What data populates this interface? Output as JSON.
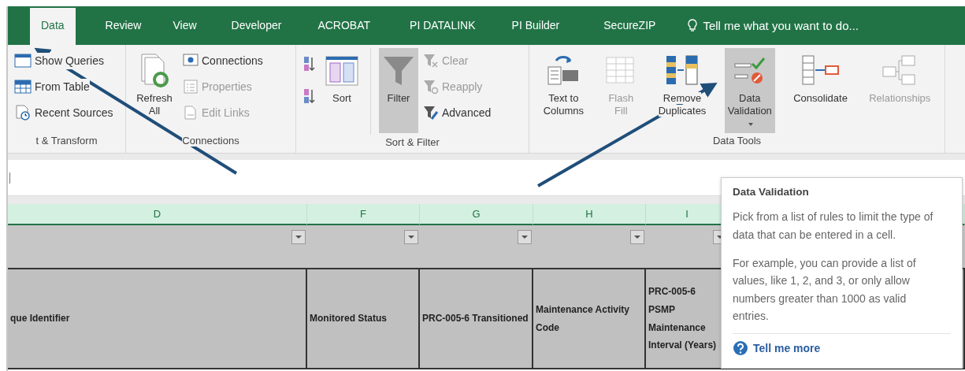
{
  "tabs": [
    {
      "label": "Data",
      "selected": true
    },
    {
      "label": "Review",
      "selected": false
    },
    {
      "label": "View",
      "selected": false
    },
    {
      "label": "Developer",
      "selected": false
    },
    {
      "label": "ACROBAT",
      "selected": false
    },
    {
      "label": "PI DATALINK",
      "selected": false
    },
    {
      "label": "PI Builder",
      "selected": false
    },
    {
      "label": "SecureZIP",
      "selected": false
    }
  ],
  "tell_me": "Tell me what you want to do...",
  "ribbon": {
    "groups": [
      {
        "label": "t & Transform",
        "buttons": [
          {
            "kind": "small",
            "label": "Show Queries",
            "disabled": false
          },
          {
            "kind": "small",
            "label": "From Table",
            "disabled": false
          },
          {
            "kind": "small",
            "label": "Recent Sources",
            "disabled": false
          }
        ]
      },
      {
        "label": "Connections",
        "buttons": [
          {
            "kind": "large",
            "label": "Refresh All",
            "disabled": false,
            "highlighted": false,
            "dropdown": false
          },
          {
            "kind": "small",
            "label": "Connections",
            "disabled": false
          },
          {
            "kind": "small",
            "label": "Properties",
            "disabled": true
          },
          {
            "kind": "small",
            "label": "Edit Links",
            "disabled": true
          }
        ]
      },
      {
        "label": "Sort & Filter",
        "buttons": [
          {
            "kind": "icon",
            "disabled": false
          },
          {
            "kind": "icon",
            "disabled": false
          },
          {
            "kind": "large",
            "label": "Sort",
            "disabled": false,
            "highlighted": false,
            "dropdown": false
          },
          {
            "kind": "large",
            "label": "Filter",
            "disabled": false,
            "highlighted": true,
            "dropdown": false
          },
          {
            "kind": "small",
            "label": "Clear",
            "disabled": true
          },
          {
            "kind": "small",
            "label": "Reapply",
            "disabled": true
          },
          {
            "kind": "small",
            "label": "Advanced",
            "disabled": false
          }
        ]
      },
      {
        "label": "Data Tools",
        "buttons": [
          {
            "kind": "large",
            "label": "Text to Columns",
            "disabled": false,
            "highlighted": false,
            "dropdown": false
          },
          {
            "kind": "large",
            "label": "Flash Fill",
            "disabled": true,
            "highlighted": false,
            "dropdown": false
          },
          {
            "kind": "large",
            "label": "Remove Duplicates",
            "disabled": false,
            "highlighted": false,
            "dropdown": false
          },
          {
            "kind": "large",
            "label": "Data Validation",
            "disabled": false,
            "highlighted": true,
            "dropdown": true
          },
          {
            "kind": "large",
            "label": "Consolidate",
            "disabled": false,
            "highlighted": false,
            "dropdown": false
          },
          {
            "kind": "large",
            "label": "Relationships",
            "disabled": true,
            "highlighted": false,
            "dropdown": false
          }
        ]
      }
    ]
  },
  "sheet": {
    "columns": [
      {
        "letter": "D",
        "heading": "que Identifier"
      },
      {
        "letter": "F",
        "heading": "Monitored Status"
      },
      {
        "letter": "G",
        "heading": "PRC-005-6 Transitioned"
      },
      {
        "letter": "H",
        "heading": "Maintenance Activity Code"
      },
      {
        "letter": "I",
        "heading": "PRC-005-6 PSMP Maintenance Interval (Years)"
      }
    ]
  },
  "tooltip": {
    "title": "Data Validation",
    "paragraphs": [
      "Pick from a list of rules to limit the type of data that can be entered in a cell.",
      "For example, you can provide a list of values, like 1, 2, and 3, or only allow numbers greater than 1000 as valid entries."
    ],
    "link": "Tell me more"
  }
}
